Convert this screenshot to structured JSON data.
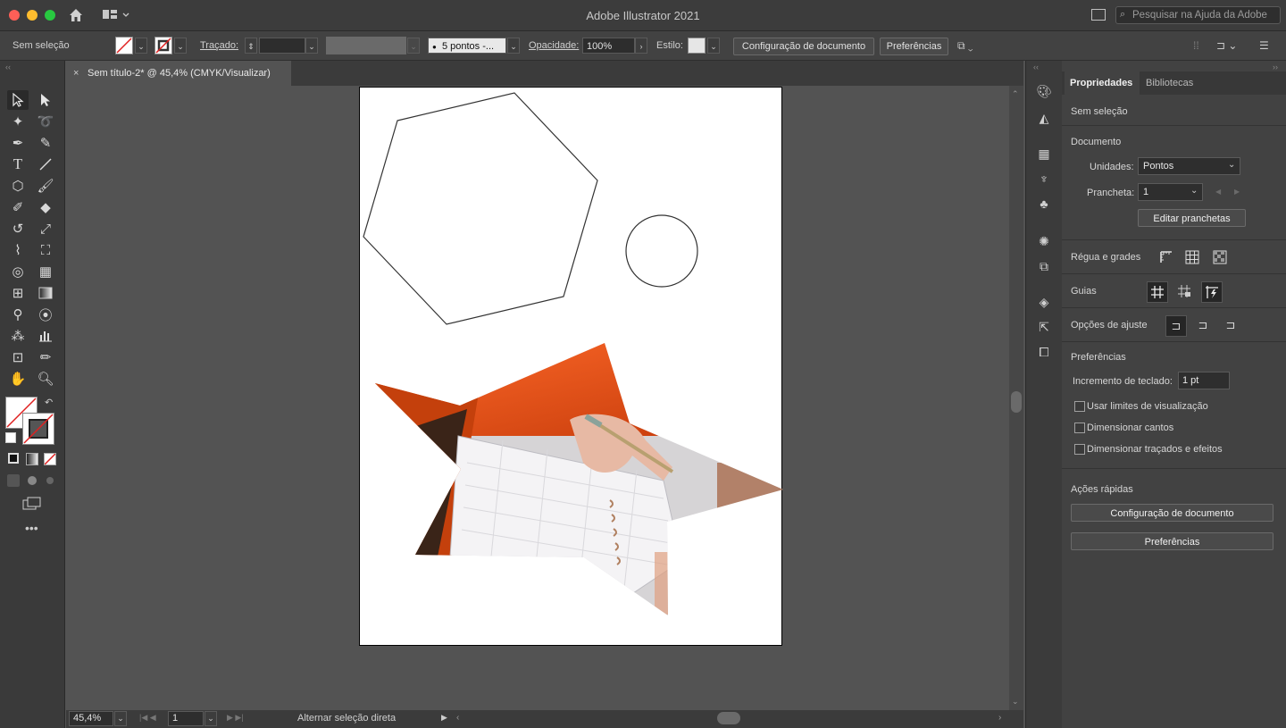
{
  "app": {
    "title": "Adobe Illustrator 2021",
    "search_placeholder": "Pesquisar na Ajuda da Adobe"
  },
  "control_bar": {
    "selection_status": "Sem seleção",
    "stroke_label": "Traçado:",
    "brush": "5 pontos -...",
    "opacity_label": "Opacidade:",
    "opacity_value": "100%",
    "style_label": "Estilo:",
    "doc_setup_button": "Configuração de documento",
    "prefs_button": "Preferências"
  },
  "document_tab": {
    "title": "Sem título-2* @ 45,4% (CMYK/Visualizar)"
  },
  "status_bar": {
    "zoom": "45,4%",
    "artboard_number": "1",
    "tool_hint": "Alternar seleção direta"
  },
  "panel": {
    "tabs": [
      "Propriedades",
      "Bibliotecas"
    ],
    "no_selection": "Sem seleção",
    "document": {
      "title": "Documento",
      "units_label": "Unidades:",
      "units_value": "Pontos",
      "artboard_label": "Prancheta:",
      "artboard_value": "1",
      "edit_artboards_button": "Editar pranchetas"
    },
    "rulers_grids_title": "Régua e grades",
    "guides_title": "Guias",
    "snap_options_title": "Opções de ajuste",
    "preferences": {
      "title": "Preferências",
      "keyboard_increment_label": "Incremento de teclado:",
      "keyboard_increment_value": "1 pt",
      "checkboxes": [
        "Usar limites de visualização",
        "Dimensionar cantos",
        "Dimensionar traçados e efeitos"
      ]
    },
    "quick_actions": {
      "title": "Ações rápidas",
      "doc_setup_button": "Configuração de documento",
      "prefs_button": "Preferências"
    }
  },
  "colors": {
    "accent_red": "#ff5f57",
    "accent_yellow": "#febc2e",
    "accent_green": "#28c840",
    "panel_bg": "#424242",
    "canvas_bg": "#535353"
  }
}
